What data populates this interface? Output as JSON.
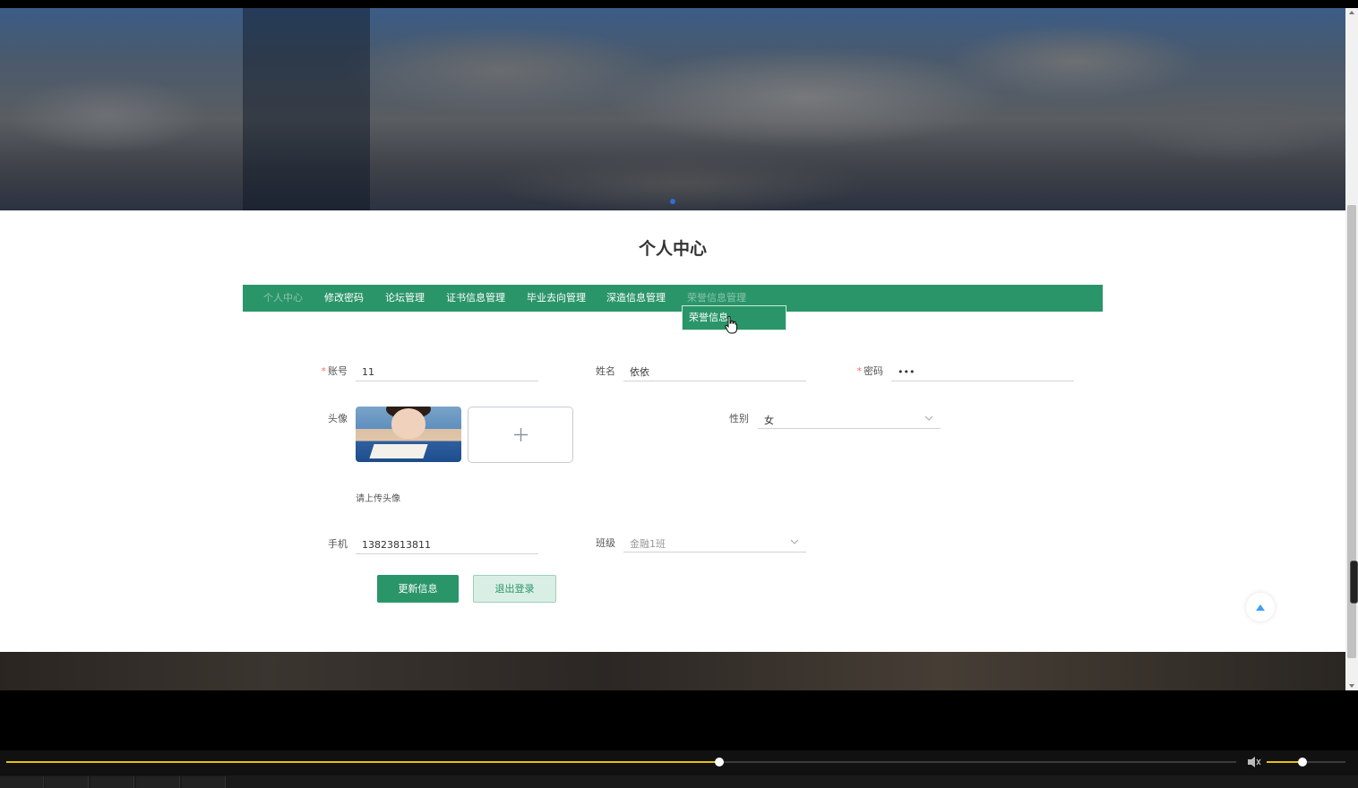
{
  "page": {
    "title": "个人中心"
  },
  "nav": {
    "items": [
      "个人中心",
      "修改密码",
      "论坛管理",
      "证书信息管理",
      "毕业去向管理",
      "深造信息管理",
      "荣誉信息管理"
    ],
    "dropdown": [
      "荣誉信息"
    ]
  },
  "form": {
    "account_label": "账号",
    "account_value": "11",
    "name_label": "姓名",
    "name_value": "依依",
    "password_label": "密码",
    "password_value": "•••",
    "avatar_label": "头像",
    "avatar_hint": "请上传头像",
    "gender_label": "性别",
    "gender_value": "女",
    "phone_label": "手机",
    "phone_value": "13823813811",
    "class_label": "班级",
    "class_value": "金融1班",
    "update_button": "更新信息",
    "logout_button": "退出登录"
  },
  "player": {
    "progress": 0.58,
    "volume": 0.45
  },
  "colors": {
    "primary": "#2a9569",
    "required": "#f56c6c",
    "progress": "#e7c116",
    "backtop": "#409eff"
  }
}
